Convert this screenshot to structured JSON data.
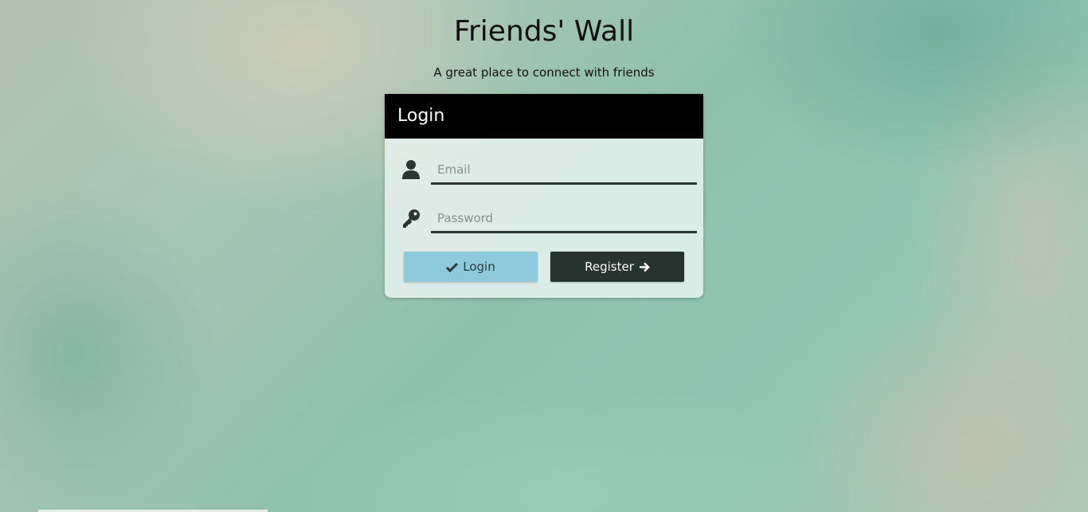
{
  "header": {
    "title": "Friends' Wall",
    "tagline": "A great place to connect with friends"
  },
  "login_panel": {
    "title": "Login",
    "email": {
      "icon": "user-icon",
      "placeholder": "Email",
      "value": ""
    },
    "password": {
      "icon": "key-icon",
      "placeholder": "Password",
      "value": ""
    },
    "buttons": {
      "login_label": "Login",
      "login_icon": "checkmark-icon",
      "register_label": "Register",
      "register_icon": "arrow-right-icon"
    }
  },
  "colors": {
    "panel_header": "#000000",
    "login_button": "#8ecadb",
    "register_button": "#27332f",
    "input_underline": "#2a3430"
  }
}
